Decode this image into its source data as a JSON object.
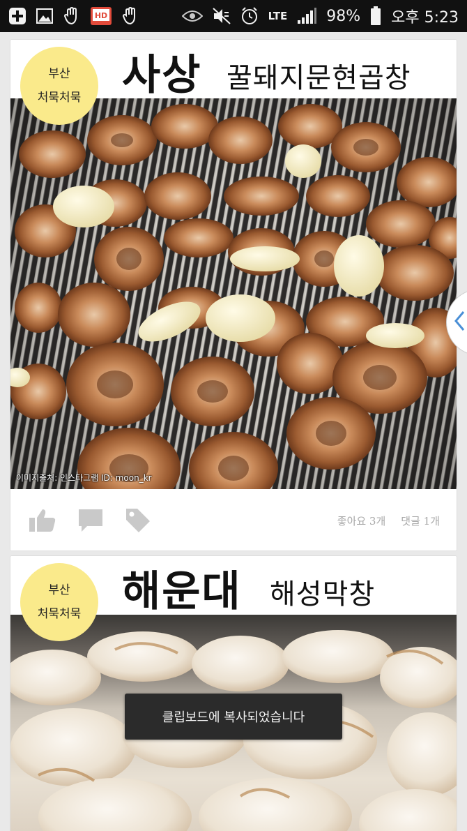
{
  "status_bar": {
    "icons": [
      "add-icon",
      "image-icon",
      "hand-icon",
      "hd-icon",
      "hand-icon",
      "eye-icon",
      "mute-icon",
      "alarm-icon",
      "lte-icon",
      "signal-icon",
      "battery-icon"
    ],
    "hd_label": "HD",
    "lte_label": "LTE",
    "battery": "98%",
    "time": "오후 5:23"
  },
  "posts": [
    {
      "badge": {
        "line1": "부산",
        "line2": "처묵처묵"
      },
      "title_big": "사상",
      "title_small": "꿀돼지문현곱창",
      "image_credit": "이미지출처: 인스타그램 ID: moon_kr",
      "actions": {
        "icons": [
          "like-icon",
          "comment-icon",
          "tag-icon"
        ]
      },
      "likes": "좋아요 3개",
      "comments": "댓글 1개"
    },
    {
      "badge": {
        "line1": "부산",
        "line2": "처묵처묵"
      },
      "title_big": "해운대",
      "title_small": "해성막창"
    }
  ],
  "toast": "클립보드에 복사되었습니다",
  "colors": {
    "status_bar_bg": "#111111",
    "badge_yellow": "#faea8b",
    "feed_bg": "#e9e9e9",
    "toast_bg": "#2b2b2b",
    "handle_arrow": "#4a8fd6"
  }
}
